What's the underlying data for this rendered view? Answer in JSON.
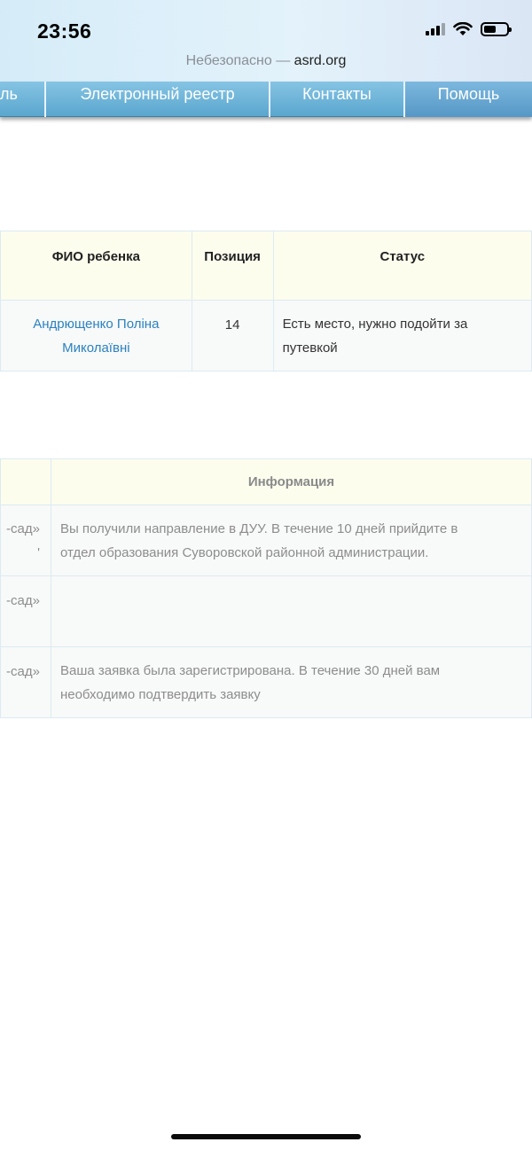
{
  "status_bar": {
    "time": "23:56"
  },
  "browser": {
    "security_label": "Небезопасно",
    "separator": "—",
    "domain": "asrd.org"
  },
  "nav": {
    "items": [
      {
        "label": "ль"
      },
      {
        "label": "Электронный реестр"
      },
      {
        "label": "Контакты"
      },
      {
        "label": "Помощь"
      }
    ]
  },
  "children_table": {
    "headers": {
      "name": "ФИО ребенка",
      "position": "Позиция",
      "status": "Статус"
    },
    "rows": [
      {
        "name_line1": "Андрющенко Поліна",
        "name_line2": "Миколаївні",
        "position": "14",
        "status_line1": "Есть место, нужно подойти за",
        "status_line2": "путевкой"
      }
    ]
  },
  "history_table": {
    "headers": {
      "info": "Информация"
    },
    "rows": [
      {
        "left_line1": "-сад»",
        "left_line2": "'",
        "info_line1": "Вы получили направление в ДУУ. В течение 10 дней прийдите в",
        "info_line2": "отдел образования Суворовской районной администрации."
      },
      {
        "left_line1": "-сад»",
        "left_line2": "",
        "info_line1": "",
        "info_line2": ""
      },
      {
        "left_line1": "-сад»",
        "left_line2": "",
        "info_line1": "Ваша заявка была зарегистрирована. В течение 30 дней вам",
        "info_line2": "необходимо подтвердить заявку"
      }
    ]
  }
}
